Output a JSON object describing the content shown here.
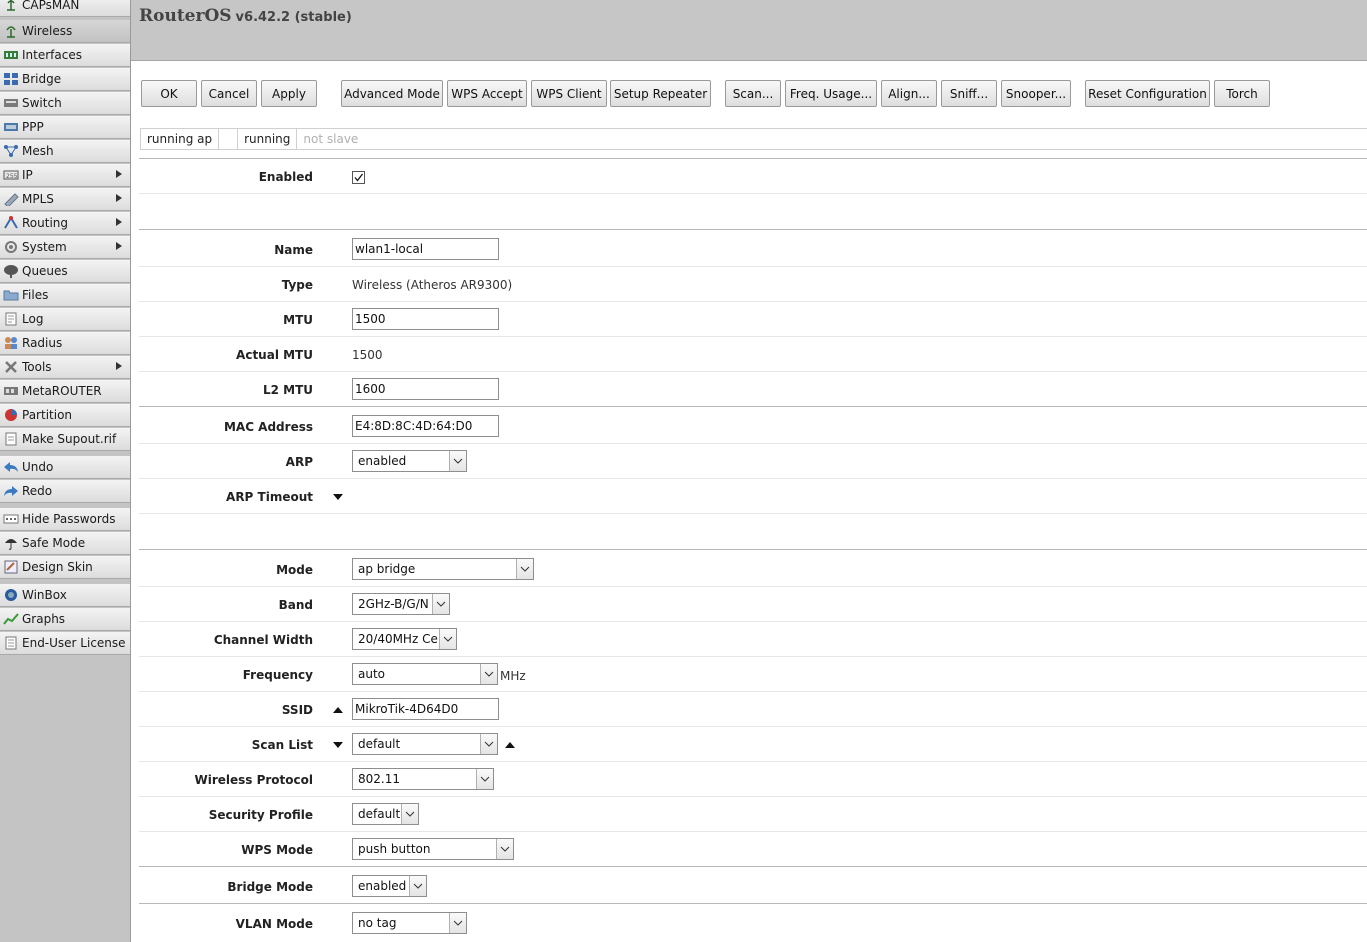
{
  "sidebar": {
    "items": [
      {
        "label": "CAPsMAN",
        "icon": "capsman-icon"
      },
      {
        "label": "Wireless",
        "icon": "wireless-icon"
      },
      {
        "label": "Interfaces",
        "icon": "interfaces-icon"
      },
      {
        "label": "Bridge",
        "icon": "bridge-icon"
      },
      {
        "label": "Switch",
        "icon": "switch-icon"
      },
      {
        "label": "PPP",
        "icon": "ppp-icon"
      },
      {
        "label": "Mesh",
        "icon": "mesh-icon"
      },
      {
        "label": "IP",
        "icon": "ip-icon"
      },
      {
        "label": "MPLS",
        "icon": "mpls-icon"
      },
      {
        "label": "Routing",
        "icon": "routing-icon"
      },
      {
        "label": "System",
        "icon": "system-icon"
      },
      {
        "label": "Queues",
        "icon": "queues-icon"
      },
      {
        "label": "Files",
        "icon": "files-icon"
      },
      {
        "label": "Log",
        "icon": "log-icon"
      },
      {
        "label": "Radius",
        "icon": "radius-icon"
      },
      {
        "label": "Tools",
        "icon": "tools-icon"
      },
      {
        "label": "MetaROUTER",
        "icon": "metarouter-icon"
      },
      {
        "label": "Partition",
        "icon": "partition-icon"
      },
      {
        "label": "Make Supout.rif",
        "icon": "supout-icon"
      },
      {
        "label": "Undo",
        "icon": "undo-icon"
      },
      {
        "label": "Redo",
        "icon": "redo-icon"
      },
      {
        "label": "Hide Passwords",
        "icon": "hide-passwords-icon"
      },
      {
        "label": "Safe Mode",
        "icon": "safe-mode-icon"
      },
      {
        "label": "Design Skin",
        "icon": "design-skin-icon"
      },
      {
        "label": "WinBox",
        "icon": "winbox-icon"
      },
      {
        "label": "Graphs",
        "icon": "graphs-icon"
      },
      {
        "label": "End-User License",
        "icon": "license-icon"
      }
    ],
    "active": "Wireless"
  },
  "header": {
    "title": "RouterOS",
    "version": "v6.42.2 (stable)"
  },
  "toolbar": {
    "ok": "OK",
    "cancel": "Cancel",
    "apply": "Apply",
    "advanced_mode": "Advanced Mode",
    "wps_accept": "WPS Accept",
    "wps_client": "WPS Client",
    "setup_repeater": "Setup Repeater",
    "scan": "Scan...",
    "freq_usage": "Freq. Usage...",
    "align": "Align...",
    "sniff": "Sniff...",
    "snooper": "Snooper...",
    "reset_configuration": "Reset Configuration",
    "torch": "Torch"
  },
  "status": {
    "cell1": "running ap",
    "cell2": "",
    "cell3": "running",
    "cell4": "not slave"
  },
  "form": {
    "enabled": {
      "label": "Enabled",
      "checked": true
    },
    "name": {
      "label": "Name",
      "value": "wlan1-local"
    },
    "type": {
      "label": "Type",
      "value": "Wireless (Atheros AR9300)"
    },
    "mtu": {
      "label": "MTU",
      "value": "1500"
    },
    "actual_mtu": {
      "label": "Actual MTU",
      "value": "1500"
    },
    "l2_mtu": {
      "label": "L2 MTU",
      "value": "1600"
    },
    "mac_address": {
      "label": "MAC Address",
      "value": "E4:8D:8C:4D:64:D0"
    },
    "arp": {
      "label": "ARP",
      "value": "enabled"
    },
    "arp_timeout": {
      "label": "ARP Timeout"
    },
    "mode": {
      "label": "Mode",
      "value": "ap bridge"
    },
    "band": {
      "label": "Band",
      "value": "2GHz-B/G/N"
    },
    "channel_width": {
      "label": "Channel Width",
      "value": "20/40MHz Ce"
    },
    "frequency": {
      "label": "Frequency",
      "value": "auto",
      "unit": "MHz"
    },
    "ssid": {
      "label": "SSID",
      "value": "MikroTik-4D64D0"
    },
    "scan_list": {
      "label": "Scan List",
      "value": "default"
    },
    "wireless_protocol": {
      "label": "Wireless Protocol",
      "value": "802.11"
    },
    "security_profile": {
      "label": "Security Profile",
      "value": "default"
    },
    "wps_mode": {
      "label": "WPS Mode",
      "value": "push button"
    },
    "bridge_mode": {
      "label": "Bridge Mode",
      "value": "enabled"
    },
    "vlan_mode": {
      "label": "VLAN Mode",
      "value": "no tag"
    }
  }
}
